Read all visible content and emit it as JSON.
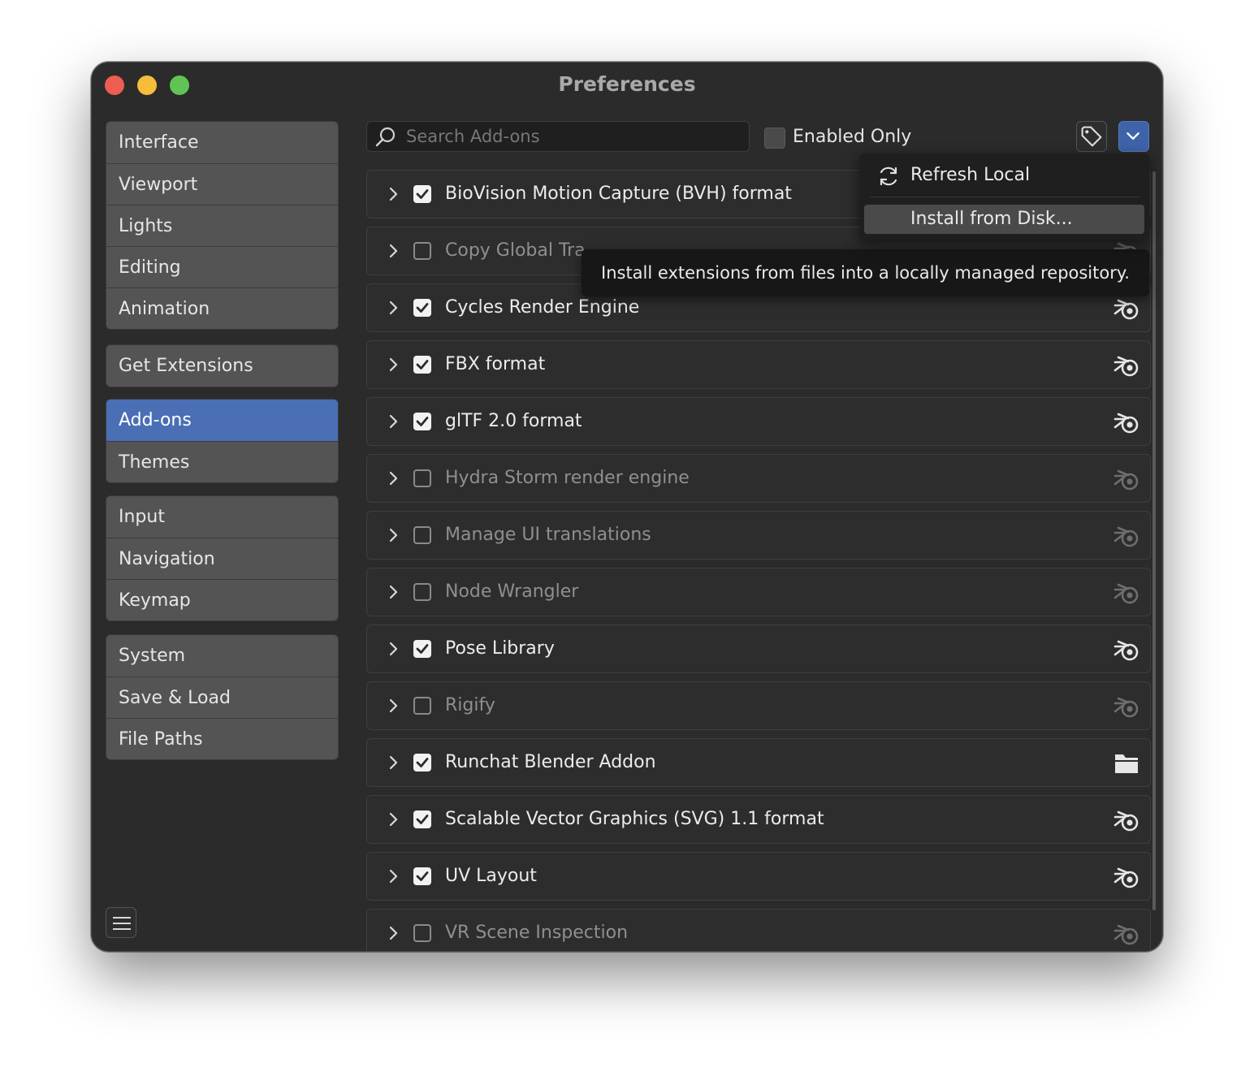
{
  "window": {
    "title": "Preferences"
  },
  "sidebar": {
    "groups": [
      [
        {
          "label": "Interface"
        },
        {
          "label": "Viewport"
        },
        {
          "label": "Lights"
        },
        {
          "label": "Editing"
        },
        {
          "label": "Animation"
        }
      ],
      [
        {
          "label": "Get Extensions"
        }
      ],
      [
        {
          "label": "Add-ons",
          "active": true
        },
        {
          "label": "Themes"
        }
      ],
      [
        {
          "label": "Input"
        },
        {
          "label": "Navigation"
        },
        {
          "label": "Keymap"
        }
      ],
      [
        {
          "label": "System"
        },
        {
          "label": "Save & Load"
        },
        {
          "label": "File Paths"
        }
      ]
    ]
  },
  "toolbar": {
    "search_placeholder": "Search Add-ons",
    "search_value": "",
    "enabled_only_label": "Enabled Only",
    "enabled_only_checked": false
  },
  "addons": [
    {
      "name": "BioVision Motion Capture (BVH) format",
      "enabled": true,
      "icon": "blender-icon"
    },
    {
      "name": "Copy Global Tra",
      "enabled": false,
      "icon": "blender-icon"
    },
    {
      "name": "Cycles Render Engine",
      "enabled": true,
      "icon": "blender-icon"
    },
    {
      "name": "FBX format",
      "enabled": true,
      "icon": "blender-icon"
    },
    {
      "name": "glTF 2.0 format",
      "enabled": true,
      "icon": "blender-icon"
    },
    {
      "name": "Hydra Storm render engine",
      "enabled": false,
      "icon": "blender-icon"
    },
    {
      "name": "Manage UI translations",
      "enabled": false,
      "icon": "blender-icon"
    },
    {
      "name": "Node Wrangler",
      "enabled": false,
      "icon": "blender-icon"
    },
    {
      "name": "Pose Library",
      "enabled": true,
      "icon": "blender-icon"
    },
    {
      "name": "Rigify",
      "enabled": false,
      "icon": "blender-icon"
    },
    {
      "name": "Runchat Blender Addon",
      "enabled": true,
      "icon": "folder-icon"
    },
    {
      "name": "Scalable Vector Graphics (SVG) 1.1 format",
      "enabled": true,
      "icon": "blender-icon"
    },
    {
      "name": "UV Layout",
      "enabled": true,
      "icon": "blender-icon"
    },
    {
      "name": "VR Scene Inspection",
      "enabled": false,
      "icon": "blender-icon"
    }
  ],
  "menu": {
    "items": [
      {
        "label": "Refresh Local",
        "icon": "refresh-icon"
      },
      {
        "label": "Install from Disk..."
      }
    ]
  },
  "tooltip": {
    "text": "Install extensions from files into a locally managed repository."
  },
  "colors": {
    "accent": "#4a6fb5",
    "window_bg": "#2b2b2b",
    "nav_bg": "#545454"
  }
}
